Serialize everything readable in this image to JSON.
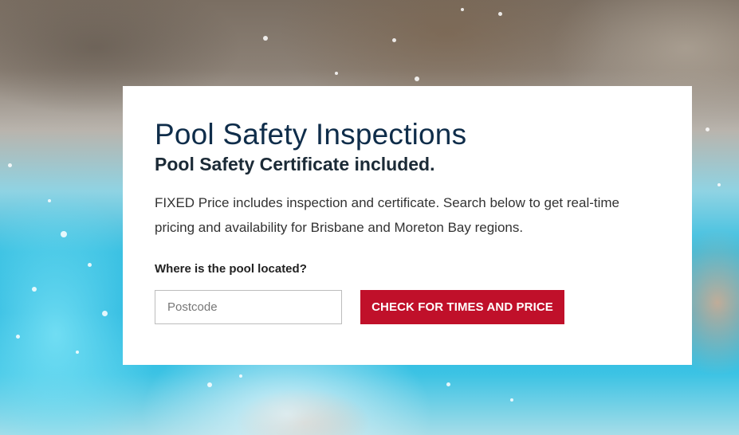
{
  "hero": {
    "title": "Pool Safety Inspections",
    "subtitle": "Pool Safety Certificate included.",
    "description": "FIXED Price includes inspection and certificate. Search below to get real-time pricing and availability for Brisbane and Moreton Bay regions.",
    "location_label": "Where is the pool located?",
    "postcode_placeholder": "Postcode",
    "postcode_value": "",
    "cta_label": "CHECK FOR TIMES AND PRICE"
  },
  "colors": {
    "title": "#0f2d4a",
    "cta_background": "#c0102a",
    "card_background": "#ffffff"
  }
}
